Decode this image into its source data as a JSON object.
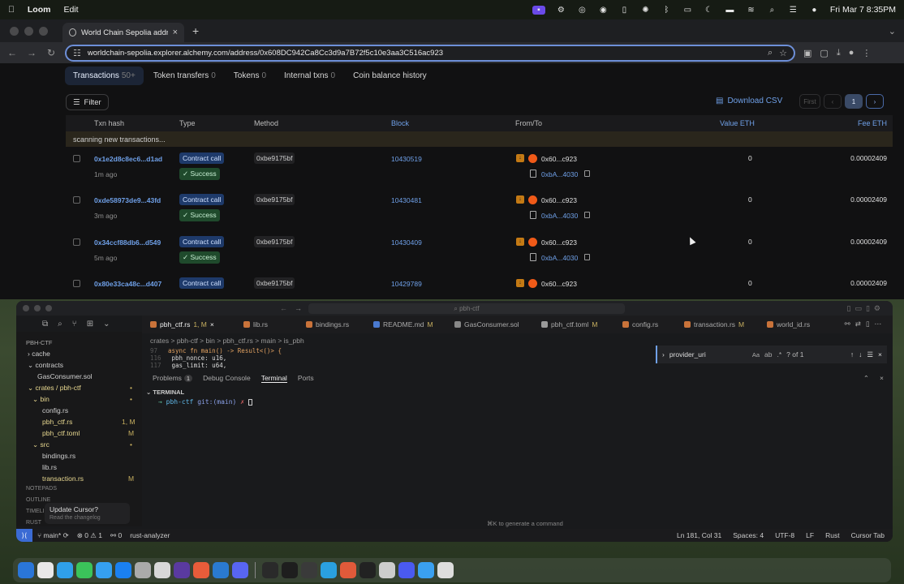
{
  "menubar": {
    "app": "Loom",
    "menu_edit": "Edit",
    "datetime": "Fri Mar 7  8:35PM"
  },
  "browser": {
    "tab_title": "World Chain Sepolia address",
    "url": "worldchain-sepolia.explorer.alchemy.com/address/0x608DC942Ca8Cc3d9a7B72f5c10e3aa3C516ac923"
  },
  "explorer": {
    "tabs": [
      {
        "label": "Transactions",
        "count": "50+"
      },
      {
        "label": "Token transfers",
        "count": "0"
      },
      {
        "label": "Tokens",
        "count": "0"
      },
      {
        "label": "Internal txns",
        "count": "0"
      },
      {
        "label": "Coin balance history",
        "count": ""
      }
    ],
    "filter_label": "Filter",
    "download_label": "Download CSV",
    "pager": {
      "first": "First",
      "current": "1"
    },
    "columns": {
      "hash": "Txn hash",
      "type": "Type",
      "method": "Method",
      "block": "Block",
      "fromto": "From/To",
      "value": "Value ETH",
      "fee": "Fee ETH"
    },
    "scanning": "scanning new transactions...",
    "rows": [
      {
        "hash": "0x1e2d8c8ec6...d1ad",
        "age": "1m ago",
        "type": "Contract call",
        "status": "Success",
        "method": "0xbe9175bf",
        "block": "10430519",
        "from": "0x60...c923",
        "to": "0xbA...4030",
        "value": "0",
        "fee": "0.00002409"
      },
      {
        "hash": "0xde58973de9...43fd",
        "age": "3m ago",
        "type": "Contract call",
        "status": "Success",
        "method": "0xbe9175bf",
        "block": "10430481",
        "from": "0x60...c923",
        "to": "0xbA...4030",
        "value": "0",
        "fee": "0.00002409"
      },
      {
        "hash": "0x34ccf88db6...d549",
        "age": "5m ago",
        "type": "Contract call",
        "status": "Success",
        "method": "0xbe9175bf",
        "block": "10430409",
        "from": "0x60...c923",
        "to": "0xbA...4030",
        "value": "0",
        "fee": "0.00002409"
      },
      {
        "hash": "0x80e33ca48c...d407",
        "age": "",
        "type": "Contract call",
        "status": "",
        "method": "0xbe9175bf",
        "block": "10429789",
        "from": "0x60...c923",
        "to": "",
        "value": "0",
        "fee": "0.00002409"
      }
    ]
  },
  "ide": {
    "search_placeholder": "pbh-ctf",
    "tabs": [
      {
        "label": "pbh_ctf.rs",
        "mod": "1, M"
      },
      {
        "label": "lib.rs",
        "mod": ""
      },
      {
        "label": "bindings.rs",
        "mod": ""
      },
      {
        "label": "README.md",
        "mod": "M"
      },
      {
        "label": "GasConsumer.sol",
        "mod": ""
      },
      {
        "label": "pbh_ctf.toml",
        "mod": "M"
      },
      {
        "label": "config.rs",
        "mod": ""
      },
      {
        "label": "transaction.rs",
        "mod": "M"
      },
      {
        "label": "world_id.rs",
        "mod": ""
      }
    ],
    "explorer_root": "PBH-CTF",
    "tree": [
      {
        "label": "cache",
        "mod": ""
      },
      {
        "label": "contracts",
        "mod": ""
      },
      {
        "label": "GasConsumer.sol",
        "mod": ""
      },
      {
        "label": "crates / pbh-ctf",
        "mod": "•"
      },
      {
        "label": "bin",
        "mod": "•"
      },
      {
        "label": "config.rs",
        "mod": ""
      },
      {
        "label": "pbh_ctf.rs",
        "mod": "1, M"
      },
      {
        "label": "pbh_ctf.toml",
        "mod": "M"
      },
      {
        "label": "src",
        "mod": "•"
      },
      {
        "label": "bindings.rs",
        "mod": ""
      },
      {
        "label": "lib.rs",
        "mod": ""
      },
      {
        "label": "transaction.rs",
        "mod": "M"
      }
    ],
    "sections": [
      "NOTEPADS",
      "OUTLINE",
      "TIMELINE",
      "RUST"
    ],
    "breadcrumb": "crates > pbh-ctf > bin > pbh_ctf.rs > main > is_pbh",
    "code_lines": [
      {
        "n": "97",
        "text": "async fn main() -> Result<()> {"
      },
      {
        "n": "116",
        "text": "    pbh_nonce: u16,"
      },
      {
        "n": "117",
        "text": "    gas_limit: u64,"
      }
    ],
    "find": {
      "query": "provider_uri",
      "result": "? of 1",
      "aa": "Aa"
    },
    "panel_tabs": [
      {
        "label": "Problems",
        "badge": "1"
      },
      {
        "label": "Debug Console",
        "badge": ""
      },
      {
        "label": "Terminal",
        "badge": ""
      },
      {
        "label": "Ports",
        "badge": ""
      }
    ],
    "terminal_title": "TERMINAL",
    "prompt": {
      "arrow": "→",
      "dir": "pbh-ctf",
      "git": "git:(main)",
      "mark": "✗"
    },
    "cmd_hint": "⌘K to generate a command",
    "update": {
      "title": "Update Cursor?",
      "sub": "Read the changelog"
    },
    "status": {
      "branch": "main*",
      "sync": "⟳",
      "errors": "0",
      "warnings": "1",
      "ports": "0",
      "lang_server": "rust-analyzer",
      "position": "Ln 181, Col 31",
      "spaces": "Spaces: 4",
      "encoding": "UTF-8",
      "eol": "LF",
      "language": "Rust",
      "cursor_tab": "Cursor Tab"
    }
  },
  "dock_colors": [
    "#2a76d8",
    "#e8e8e8",
    "#2fa0ea",
    "#3bc35a",
    "#35a0f0",
    "#1a80f0",
    "#aaaaaa",
    "#d8d8d8",
    "#5a3aa0",
    "#e85c3a",
    "#2a7ad0",
    "#5865f2",
    "#2a2a2a",
    "#1e1e1e",
    "#3a3a3a",
    "#2aa0e0",
    "#e05a3a",
    "#222222",
    "#cccccc",
    "#4a5af0",
    "#3aa0f0",
    "#dddddd"
  ]
}
